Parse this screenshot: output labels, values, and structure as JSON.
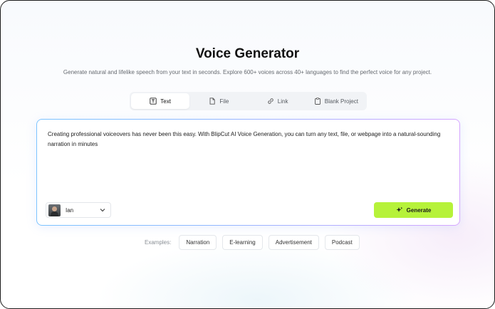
{
  "page": {
    "title": "Voice Generator",
    "subtitle": "Generate natural and lifelike speech from your text in seconds. Explore 600+ voices across 40+ languages to find the perfect voice for any project."
  },
  "tabs": [
    {
      "label": "Text",
      "icon": "text-icon",
      "active": true
    },
    {
      "label": "File",
      "icon": "file-icon",
      "active": false
    },
    {
      "label": "Link",
      "icon": "link-icon",
      "active": false
    },
    {
      "label": "Blank Project",
      "icon": "blank-project-icon",
      "active": false
    }
  ],
  "editor": {
    "text": "Creating professional voiceovers has never been this easy. With BlipCut AI Voice Generation, you can turn any text, file, or webpage into a natural-sounding narration in minutes",
    "voice": {
      "name": "Ian",
      "icon": "chevron-down-icon"
    },
    "generate_label": "Generate",
    "generate_icon": "sparkle-icon"
  },
  "examples": {
    "label": "Examples:",
    "items": [
      "Narration",
      "E-learning",
      "Advertisement",
      "Podcast"
    ]
  },
  "colors": {
    "accent": "#b6f23a",
    "border_gradient_start": "#7cc4ff",
    "border_gradient_end": "#d6a6ff"
  }
}
